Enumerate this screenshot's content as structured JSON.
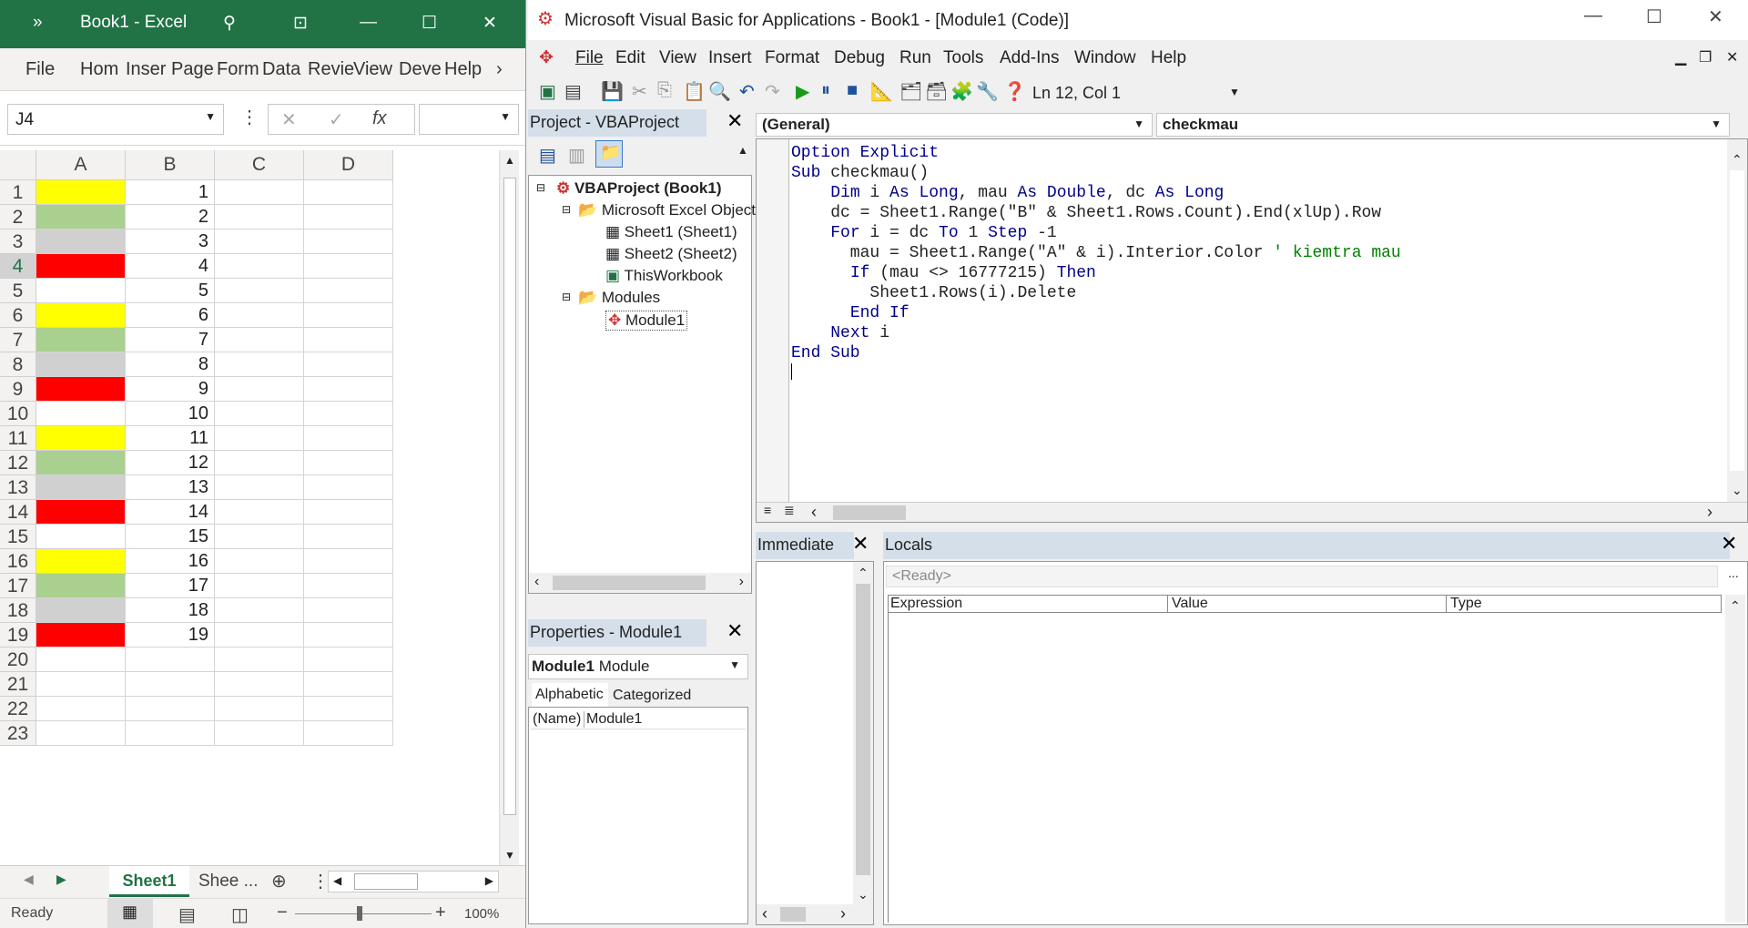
{
  "excel": {
    "title": "Book1  -  Excel",
    "ribbon_more": "»",
    "menu": [
      "File",
      "Hom",
      "Inser",
      "Page",
      "Form",
      "Data",
      "Revie",
      "View",
      "Deve",
      "Help"
    ],
    "name_box": "J4",
    "fx": "fx",
    "columns": [
      "A",
      "B",
      "C",
      "D"
    ],
    "rows": [
      {
        "n": "1",
        "a": "#ffff00",
        "b": "1"
      },
      {
        "n": "2",
        "a": "#a9d08e",
        "b": "2"
      },
      {
        "n": "3",
        "a": "#d0d0d0",
        "b": "3"
      },
      {
        "n": "4",
        "a": "#ff0000",
        "b": "4"
      },
      {
        "n": "5",
        "a": "#ffffff",
        "b": "5"
      },
      {
        "n": "6",
        "a": "#ffff00",
        "b": "6"
      },
      {
        "n": "7",
        "a": "#a9d08e",
        "b": "7"
      },
      {
        "n": "8",
        "a": "#d0d0d0",
        "b": "8"
      },
      {
        "n": "9",
        "a": "#ff0000",
        "b": "9"
      },
      {
        "n": "10",
        "a": "#ffffff",
        "b": "10"
      },
      {
        "n": "11",
        "a": "#ffff00",
        "b": "11"
      },
      {
        "n": "12",
        "a": "#a9d08e",
        "b": "12"
      },
      {
        "n": "13",
        "a": "#d0d0d0",
        "b": "13"
      },
      {
        "n": "14",
        "a": "#ff0000",
        "b": "14"
      },
      {
        "n": "15",
        "a": "#ffffff",
        "b": "15"
      },
      {
        "n": "16",
        "a": "#ffff00",
        "b": "16"
      },
      {
        "n": "17",
        "a": "#a9d08e",
        "b": "17"
      },
      {
        "n": "18",
        "a": "#d0d0d0",
        "b": "18"
      },
      {
        "n": "19",
        "a": "#ff0000",
        "b": "19"
      },
      {
        "n": "20",
        "a": "#ffffff",
        "b": ""
      },
      {
        "n": "21",
        "a": "#ffffff",
        "b": ""
      },
      {
        "n": "22",
        "a": "#ffffff",
        "b": ""
      },
      {
        "n": "23",
        "a": "#ffffff",
        "b": ""
      }
    ],
    "tab_active": "Sheet1",
    "tab_other": "Shee ...",
    "status": "Ready",
    "zoom": "100%"
  },
  "vbe": {
    "title": "Microsoft Visual Basic for Applications - Book1 - [Module1 (Code)]",
    "menu": [
      "File",
      "Edit",
      "View",
      "Insert",
      "Format",
      "Debug",
      "Run",
      "Tools",
      "Add-Ins",
      "Window",
      "Help"
    ],
    "position": "Ln 12, Col 1",
    "project_title": "Project - VBAProject",
    "tree": [
      "VBAProject (Book1)",
      "Microsoft Excel Object",
      "Sheet1 (Sheet1)",
      "Sheet2 (Sheet2)",
      "ThisWorkbook",
      "Modules",
      "Module1"
    ],
    "properties_title": "Properties - Module1",
    "prop_object_bold": "Module1",
    "prop_object_type": "Module",
    "prop_tabs": [
      "Alphabetic",
      "Categorized"
    ],
    "prop_name": "(Name)",
    "prop_value": "Module1",
    "combo_general": "(General)",
    "combo_proc": "checkmau",
    "immediate_title": "Immediate",
    "locals_title": "Locals",
    "locals_ready": "<Ready>",
    "locals_cols": [
      "Expression",
      "Value",
      "Type"
    ]
  }
}
